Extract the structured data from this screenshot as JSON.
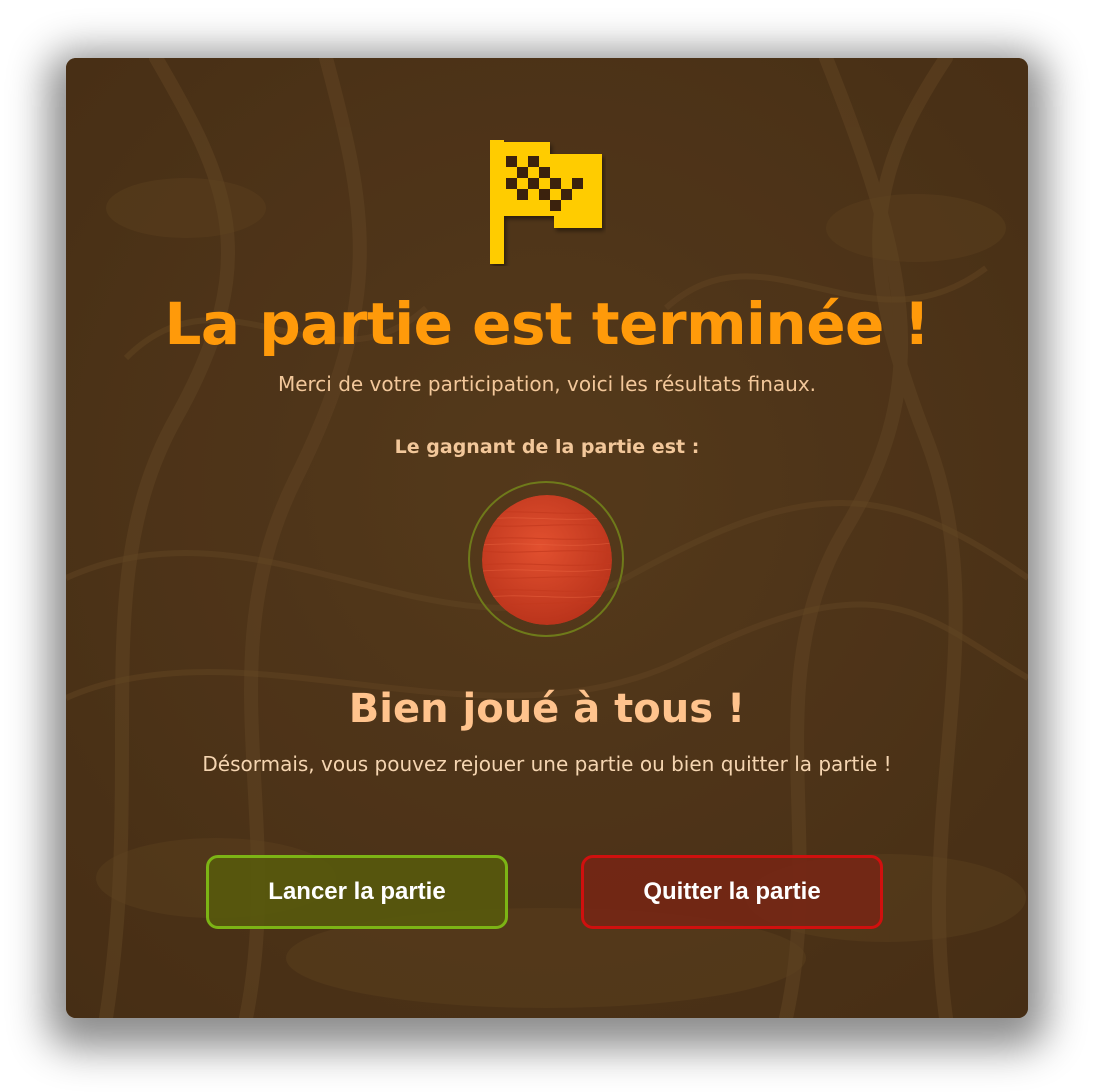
{
  "modal": {
    "title": "La partie est terminée !",
    "subtitle": "Merci de votre participation, voici les résultats finaux.",
    "winner_label": "Le gagnant de la partie est :",
    "winner": {
      "token_color": "#d9432b",
      "token_style": "wood-red-pawn"
    },
    "congrats": "Bien joué à tous !",
    "info": "Désormais, vous pouvez rejouer une partie ou bien quitter la partie !",
    "buttons": {
      "start_label": "Lancer la partie",
      "quit_label": "Quitter la partie"
    }
  },
  "colors": {
    "background": "#553a1c",
    "title": "#ff9a0a",
    "flag": "#ffcc00",
    "start_border": "#7cb415",
    "quit_border": "#d0100e"
  },
  "icons": {
    "flag": "checkered-flag-icon"
  }
}
